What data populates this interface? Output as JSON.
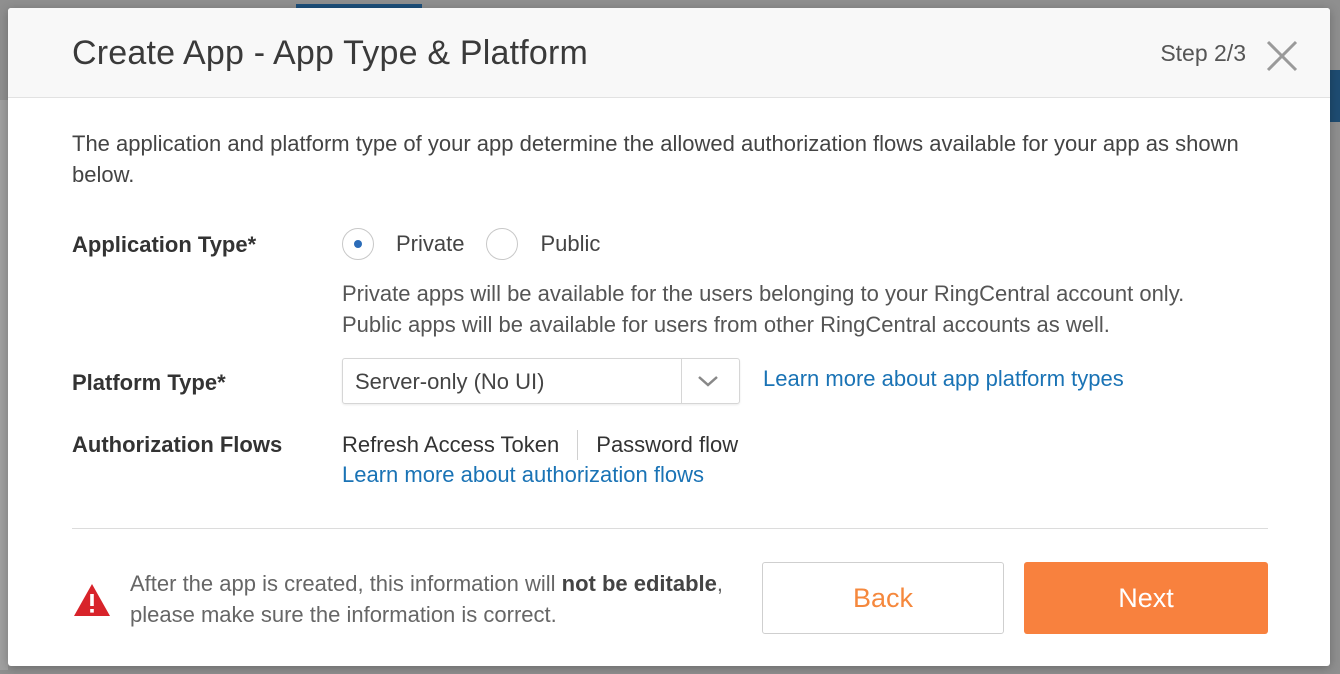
{
  "modal": {
    "title": "Create App - App Type & Platform",
    "step": "Step 2/3",
    "close_icon": "close-icon"
  },
  "intro": "The application and platform type of your app determine the allowed authorization flows available for your app as shown below.",
  "application_type": {
    "label": "Application Type*",
    "options": [
      {
        "label": "Private",
        "checked": true
      },
      {
        "label": "Public",
        "checked": false
      }
    ],
    "description_line1": "Private apps will be available for the users belonging to your RingCentral account only.",
    "description_line2": "Public apps will be available for users from other RingCentral accounts as well."
  },
  "platform_type": {
    "label": "Platform Type*",
    "selected": "Server-only (No UI)",
    "caret_icon": "chevron-down-icon",
    "learn_more_link": "Learn more about app platform types"
  },
  "authorization_flows": {
    "label": "Authorization Flows",
    "flows": [
      "Refresh Access Token",
      "Password flow"
    ],
    "learn_more_link": "Learn more about authorization flows"
  },
  "footer": {
    "warning_icon": "warning-icon",
    "warning_part1": "After the app is created, this information will ",
    "warning_bold1": "not be editable",
    "warning_part2": ", please make sure the information is correct.",
    "back_label": "Back",
    "next_label": "Next"
  },
  "colors": {
    "accent_orange": "#f8813e",
    "link_blue": "#1a73b5",
    "radio_selected": "#2b6cb8",
    "warning_red": "#d8232a"
  }
}
